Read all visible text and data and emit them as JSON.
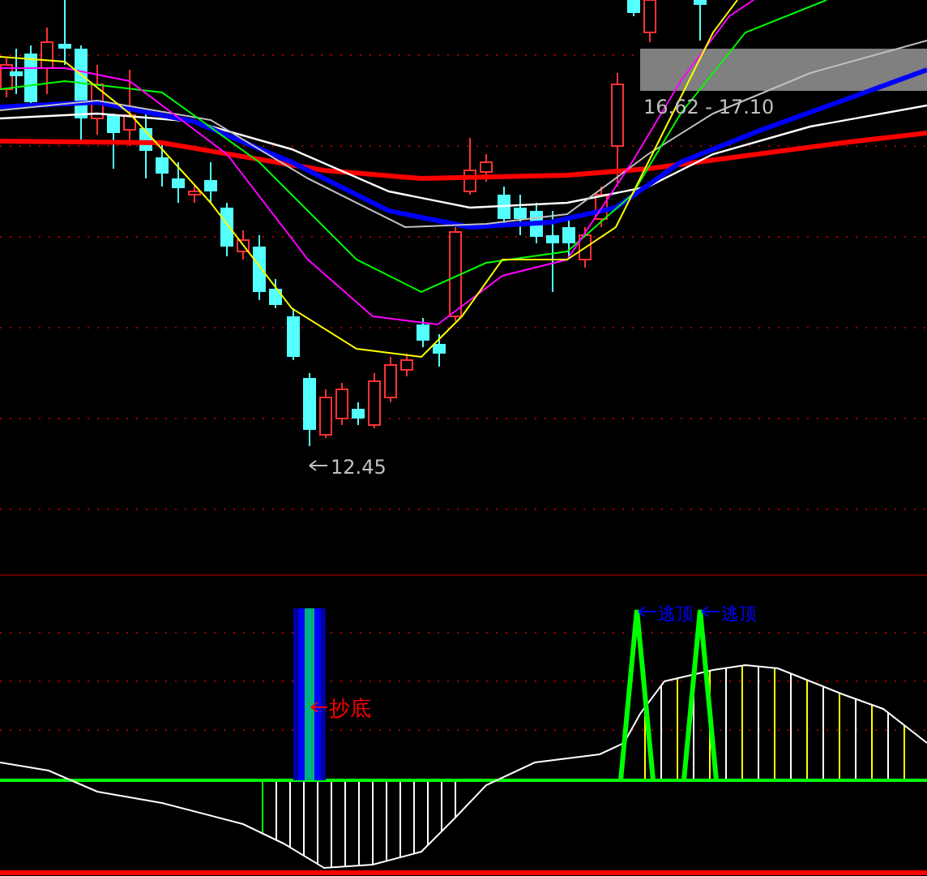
{
  "price_chart": {
    "range_label": "16.62 - 17.10",
    "low_label": "12.45"
  },
  "indicator": {
    "signals": [
      {
        "kind": "bottom",
        "label": "抄底"
      },
      {
        "kind": "top",
        "label": "逃顶"
      },
      {
        "kind": "top",
        "label": "逃顶"
      }
    ]
  }
}
